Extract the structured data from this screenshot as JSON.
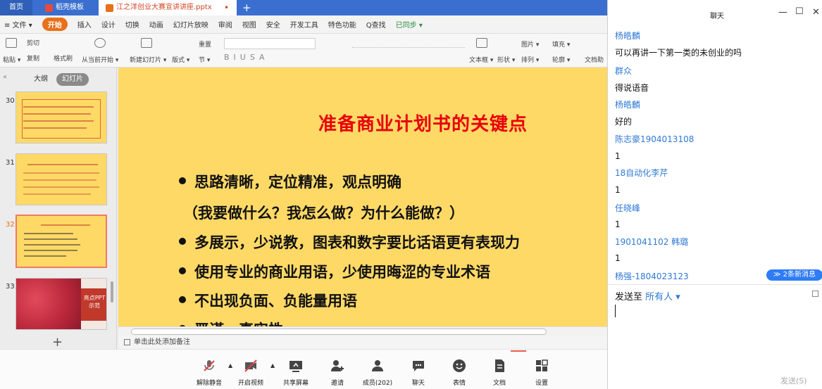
{
  "tabs": {
    "home": "首页",
    "templates": "稻壳模板",
    "document": "江之洋创业大赛宣讲讲座.pptx",
    "new_tab": "+"
  },
  "menubar": {
    "file": "≡ 文件 ▾",
    "items": [
      "开始",
      "插入",
      "设计",
      "切换",
      "动画",
      "幻灯片放映",
      "审阅",
      "视图",
      "安全",
      "开发工具",
      "特色功能",
      "Q查找"
    ],
    "sync": "已同步 ▾"
  },
  "toolbar": {
    "paste": "粘贴 ▾",
    "cut": "剪切",
    "copy": "复制",
    "format_painter": "格式刷",
    "from_current": "从当前开始 ▾",
    "new_slide": "新建幻灯片 ▾",
    "layout": "版式 ▾",
    "section": "节 ▾",
    "reset": "重置",
    "textbox": "文本框 ▾",
    "shape": "形状 ▾",
    "arrange": "排列 ▾",
    "picture": "图片 ▾",
    "fill": "填充 ▾",
    "outline": "轮廓 ▾",
    "doc_assist": "文档助"
  },
  "left_panel": {
    "outline_tab": "大纲",
    "slides_tab": "幻灯片",
    "slide_numbers": [
      "30",
      "31",
      "32",
      "33"
    ],
    "thumb33_text": "亮点PPT 示范",
    "add": "+"
  },
  "slide": {
    "title": "准备商业计划书的关键点",
    "bullets": [
      "思路清晰，定位精准，观点明确",
      "（我要做什么？我怎么做？为什么能做？）",
      "多展示，少说教，图表和数字要比话语更有表现力",
      "使用专业的商业用语，少使用晦涩的专业术语",
      "不出现负面、负能量用语",
      "严谨、真实性"
    ]
  },
  "notes_placeholder": "单击此处添加备注",
  "meeting_bar": {
    "unmute": "解除静音",
    "start_video": "开启视频",
    "share_screen": "共享屏幕",
    "invite": "邀请",
    "members": "成员(202)",
    "chat": "聊天",
    "reactions": "表情",
    "docs": "文档",
    "settings": "设置"
  },
  "chat": {
    "title": "聊天",
    "messages": [
      {
        "sender": "杨皓麟",
        "text": "可以再讲一下第一类的未创业的吗"
      },
      {
        "sender": "群众",
        "text": "得说语音"
      },
      {
        "sender": "杨皓麟",
        "text": "好的"
      },
      {
        "sender": "陈志豪1904013108",
        "text": "1"
      },
      {
        "sender": "18自动化李芹",
        "text": "1"
      },
      {
        "sender": "任晓峰",
        "text": "1"
      },
      {
        "sender": "1901041102 韩璐",
        "text": "1"
      },
      {
        "sender": "杨强-1804023123",
        "text": ""
      }
    ],
    "new_messages": "≫ 2条新消息",
    "send_to_label": "发送至",
    "send_to_target": "所有人 ▾",
    "send_button": "发送(S)"
  }
}
